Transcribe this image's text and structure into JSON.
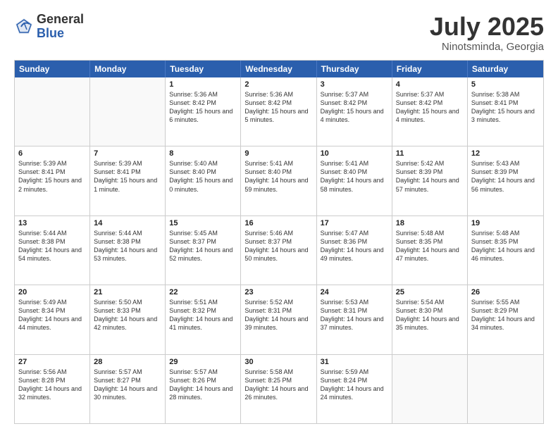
{
  "logo": {
    "general": "General",
    "blue": "Blue"
  },
  "title": "July 2025",
  "location": "Ninotsminda, Georgia",
  "weekdays": [
    "Sunday",
    "Monday",
    "Tuesday",
    "Wednesday",
    "Thursday",
    "Friday",
    "Saturday"
  ],
  "weeks": [
    [
      {
        "day": "",
        "sunrise": "",
        "sunset": "",
        "daylight": ""
      },
      {
        "day": "",
        "sunrise": "",
        "sunset": "",
        "daylight": ""
      },
      {
        "day": "1",
        "sunrise": "Sunrise: 5:36 AM",
        "sunset": "Sunset: 8:42 PM",
        "daylight": "Daylight: 15 hours and 6 minutes."
      },
      {
        "day": "2",
        "sunrise": "Sunrise: 5:36 AM",
        "sunset": "Sunset: 8:42 PM",
        "daylight": "Daylight: 15 hours and 5 minutes."
      },
      {
        "day": "3",
        "sunrise": "Sunrise: 5:37 AM",
        "sunset": "Sunset: 8:42 PM",
        "daylight": "Daylight: 15 hours and 4 minutes."
      },
      {
        "day": "4",
        "sunrise": "Sunrise: 5:37 AM",
        "sunset": "Sunset: 8:42 PM",
        "daylight": "Daylight: 15 hours and 4 minutes."
      },
      {
        "day": "5",
        "sunrise": "Sunrise: 5:38 AM",
        "sunset": "Sunset: 8:41 PM",
        "daylight": "Daylight: 15 hours and 3 minutes."
      }
    ],
    [
      {
        "day": "6",
        "sunrise": "Sunrise: 5:39 AM",
        "sunset": "Sunset: 8:41 PM",
        "daylight": "Daylight: 15 hours and 2 minutes."
      },
      {
        "day": "7",
        "sunrise": "Sunrise: 5:39 AM",
        "sunset": "Sunset: 8:41 PM",
        "daylight": "Daylight: 15 hours and 1 minute."
      },
      {
        "day": "8",
        "sunrise": "Sunrise: 5:40 AM",
        "sunset": "Sunset: 8:40 PM",
        "daylight": "Daylight: 15 hours and 0 minutes."
      },
      {
        "day": "9",
        "sunrise": "Sunrise: 5:41 AM",
        "sunset": "Sunset: 8:40 PM",
        "daylight": "Daylight: 14 hours and 59 minutes."
      },
      {
        "day": "10",
        "sunrise": "Sunrise: 5:41 AM",
        "sunset": "Sunset: 8:40 PM",
        "daylight": "Daylight: 14 hours and 58 minutes."
      },
      {
        "day": "11",
        "sunrise": "Sunrise: 5:42 AM",
        "sunset": "Sunset: 8:39 PM",
        "daylight": "Daylight: 14 hours and 57 minutes."
      },
      {
        "day": "12",
        "sunrise": "Sunrise: 5:43 AM",
        "sunset": "Sunset: 8:39 PM",
        "daylight": "Daylight: 14 hours and 56 minutes."
      }
    ],
    [
      {
        "day": "13",
        "sunrise": "Sunrise: 5:44 AM",
        "sunset": "Sunset: 8:38 PM",
        "daylight": "Daylight: 14 hours and 54 minutes."
      },
      {
        "day": "14",
        "sunrise": "Sunrise: 5:44 AM",
        "sunset": "Sunset: 8:38 PM",
        "daylight": "Daylight: 14 hours and 53 minutes."
      },
      {
        "day": "15",
        "sunrise": "Sunrise: 5:45 AM",
        "sunset": "Sunset: 8:37 PM",
        "daylight": "Daylight: 14 hours and 52 minutes."
      },
      {
        "day": "16",
        "sunrise": "Sunrise: 5:46 AM",
        "sunset": "Sunset: 8:37 PM",
        "daylight": "Daylight: 14 hours and 50 minutes."
      },
      {
        "day": "17",
        "sunrise": "Sunrise: 5:47 AM",
        "sunset": "Sunset: 8:36 PM",
        "daylight": "Daylight: 14 hours and 49 minutes."
      },
      {
        "day": "18",
        "sunrise": "Sunrise: 5:48 AM",
        "sunset": "Sunset: 8:35 PM",
        "daylight": "Daylight: 14 hours and 47 minutes."
      },
      {
        "day": "19",
        "sunrise": "Sunrise: 5:48 AM",
        "sunset": "Sunset: 8:35 PM",
        "daylight": "Daylight: 14 hours and 46 minutes."
      }
    ],
    [
      {
        "day": "20",
        "sunrise": "Sunrise: 5:49 AM",
        "sunset": "Sunset: 8:34 PM",
        "daylight": "Daylight: 14 hours and 44 minutes."
      },
      {
        "day": "21",
        "sunrise": "Sunrise: 5:50 AM",
        "sunset": "Sunset: 8:33 PM",
        "daylight": "Daylight: 14 hours and 42 minutes."
      },
      {
        "day": "22",
        "sunrise": "Sunrise: 5:51 AM",
        "sunset": "Sunset: 8:32 PM",
        "daylight": "Daylight: 14 hours and 41 minutes."
      },
      {
        "day": "23",
        "sunrise": "Sunrise: 5:52 AM",
        "sunset": "Sunset: 8:31 PM",
        "daylight": "Daylight: 14 hours and 39 minutes."
      },
      {
        "day": "24",
        "sunrise": "Sunrise: 5:53 AM",
        "sunset": "Sunset: 8:31 PM",
        "daylight": "Daylight: 14 hours and 37 minutes."
      },
      {
        "day": "25",
        "sunrise": "Sunrise: 5:54 AM",
        "sunset": "Sunset: 8:30 PM",
        "daylight": "Daylight: 14 hours and 35 minutes."
      },
      {
        "day": "26",
        "sunrise": "Sunrise: 5:55 AM",
        "sunset": "Sunset: 8:29 PM",
        "daylight": "Daylight: 14 hours and 34 minutes."
      }
    ],
    [
      {
        "day": "27",
        "sunrise": "Sunrise: 5:56 AM",
        "sunset": "Sunset: 8:28 PM",
        "daylight": "Daylight: 14 hours and 32 minutes."
      },
      {
        "day": "28",
        "sunrise": "Sunrise: 5:57 AM",
        "sunset": "Sunset: 8:27 PM",
        "daylight": "Daylight: 14 hours and 30 minutes."
      },
      {
        "day": "29",
        "sunrise": "Sunrise: 5:57 AM",
        "sunset": "Sunset: 8:26 PM",
        "daylight": "Daylight: 14 hours and 28 minutes."
      },
      {
        "day": "30",
        "sunrise": "Sunrise: 5:58 AM",
        "sunset": "Sunset: 8:25 PM",
        "daylight": "Daylight: 14 hours and 26 minutes."
      },
      {
        "day": "31",
        "sunrise": "Sunrise: 5:59 AM",
        "sunset": "Sunset: 8:24 PM",
        "daylight": "Daylight: 14 hours and 24 minutes."
      },
      {
        "day": "",
        "sunrise": "",
        "sunset": "",
        "daylight": ""
      },
      {
        "day": "",
        "sunrise": "",
        "sunset": "",
        "daylight": ""
      }
    ]
  ]
}
